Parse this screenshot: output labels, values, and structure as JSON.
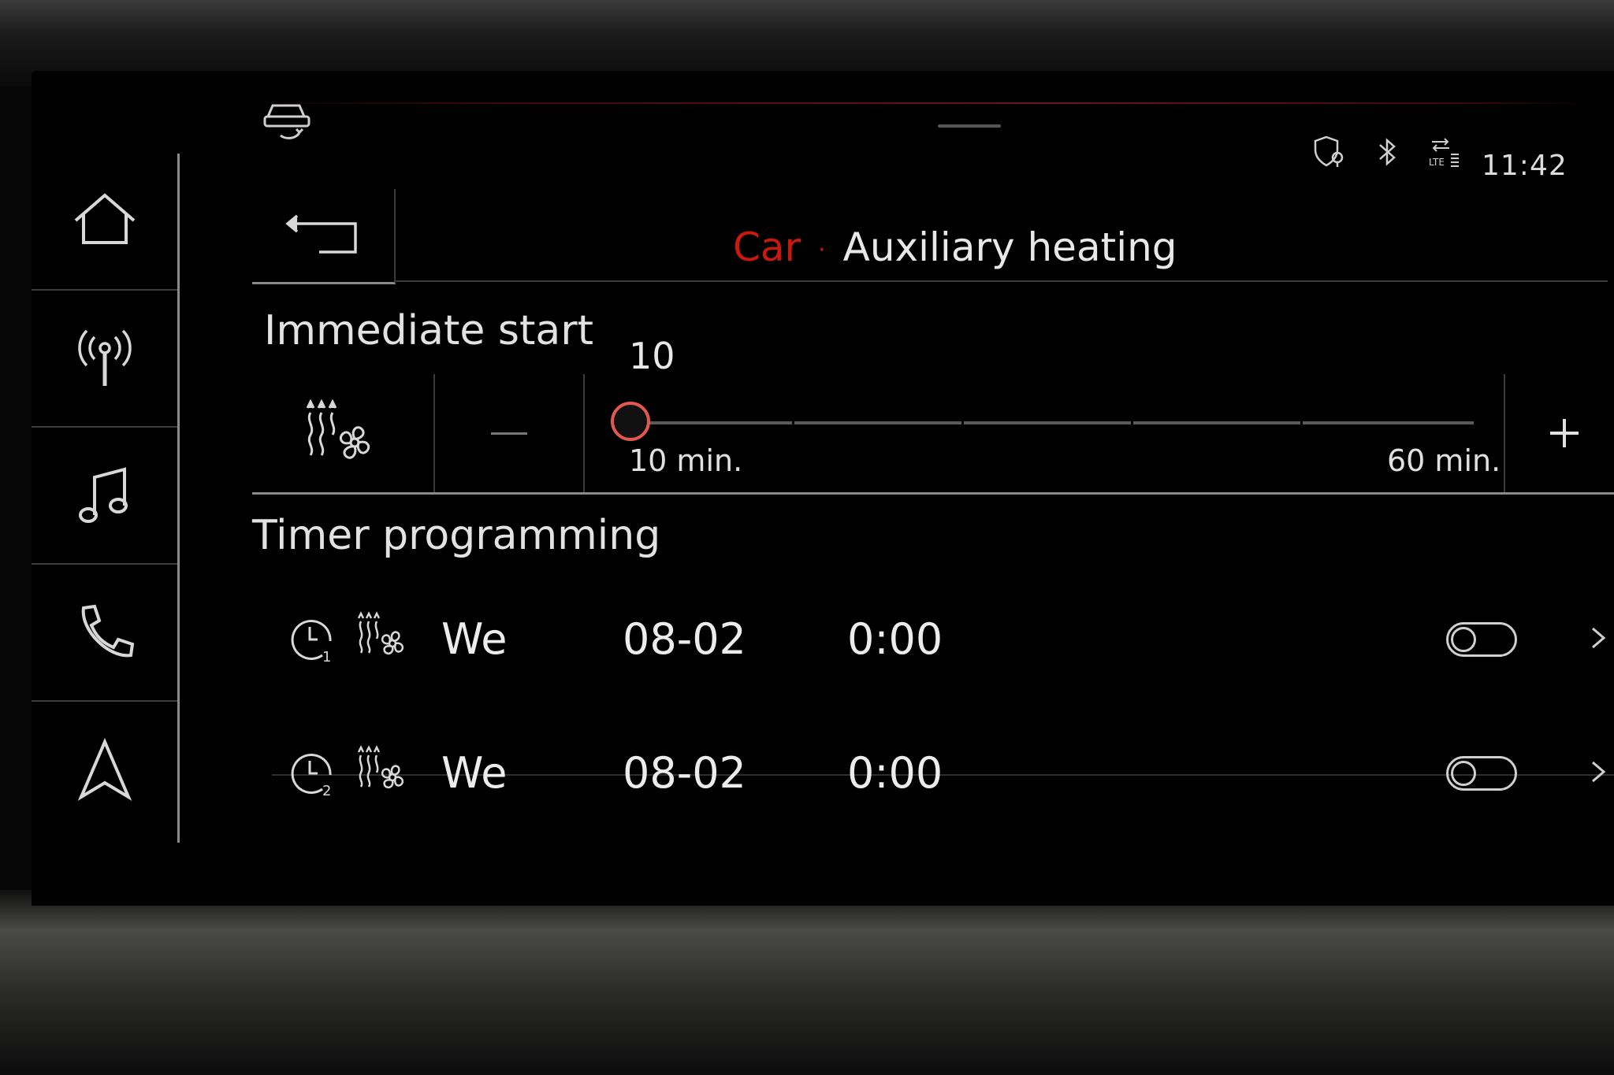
{
  "top_bar": {
    "time": "11:42",
    "icons": [
      "car-sync-icon",
      "shield-location-icon",
      "bluetooth-icon",
      "lte-signal-icon"
    ]
  },
  "sidebar": {
    "items": [
      {
        "icon": "home-icon"
      },
      {
        "icon": "radio-antenna-icon"
      },
      {
        "icon": "music-note-icon"
      },
      {
        "icon": "phone-icon"
      },
      {
        "icon": "navigation-arrow-icon"
      }
    ]
  },
  "header": {
    "parent": "Car",
    "separator": "·",
    "title": "Auxiliary heating"
  },
  "immediate_start": {
    "title": "Immediate start",
    "value": "10",
    "min_label": "10 min.",
    "max_label": "60 min.",
    "minus_label": "–",
    "plus_label": "+",
    "range": [
      10,
      60
    ],
    "current": 10
  },
  "timer_programming": {
    "title": "Timer programming",
    "timers": [
      {
        "number": "1",
        "day": "We",
        "date": "08-02",
        "time": "0:00",
        "enabled": false
      },
      {
        "number": "2",
        "day": "We",
        "date": "08-02",
        "time": "0:00",
        "enabled": false
      }
    ]
  },
  "colors": {
    "accent": "#c8190f",
    "slider_thumb": "#e05a50",
    "text": "#e6e6e6",
    "background": "#000000"
  }
}
